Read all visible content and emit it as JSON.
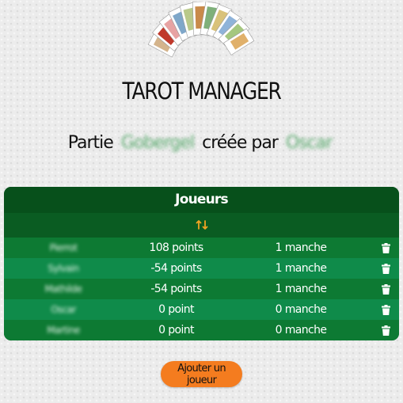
{
  "header": {
    "title": "TAROT MANAGER",
    "subtitle_prefix": "Partie",
    "game_name": "Gobergel",
    "subtitle_middle": "créée par",
    "creator": "Oscar"
  },
  "players_card": {
    "title": "Joueurs",
    "sort_icon": "sort-arrows-icon",
    "rows": [
      {
        "name": "Pierrot",
        "points": "108 points",
        "rounds": "1 manche"
      },
      {
        "name": "Sylvain",
        "points": "-54 points",
        "rounds": "1 manche"
      },
      {
        "name": "Mathilde",
        "points": "-54 points",
        "rounds": "1 manche"
      },
      {
        "name": "Oscar",
        "points": "0 point",
        "rounds": "0 manche"
      },
      {
        "name": "Martine",
        "points": "0 point",
        "rounds": "0 manche"
      }
    ]
  },
  "actions": {
    "add_player": "Ajouter un joueur"
  },
  "colors": {
    "header_green": "#07501b",
    "row_green": "#0d7a33",
    "row_alt_green": "#0f8b4a",
    "accent_orange": "#f47c1f",
    "sort_orange": "#f0a323"
  }
}
